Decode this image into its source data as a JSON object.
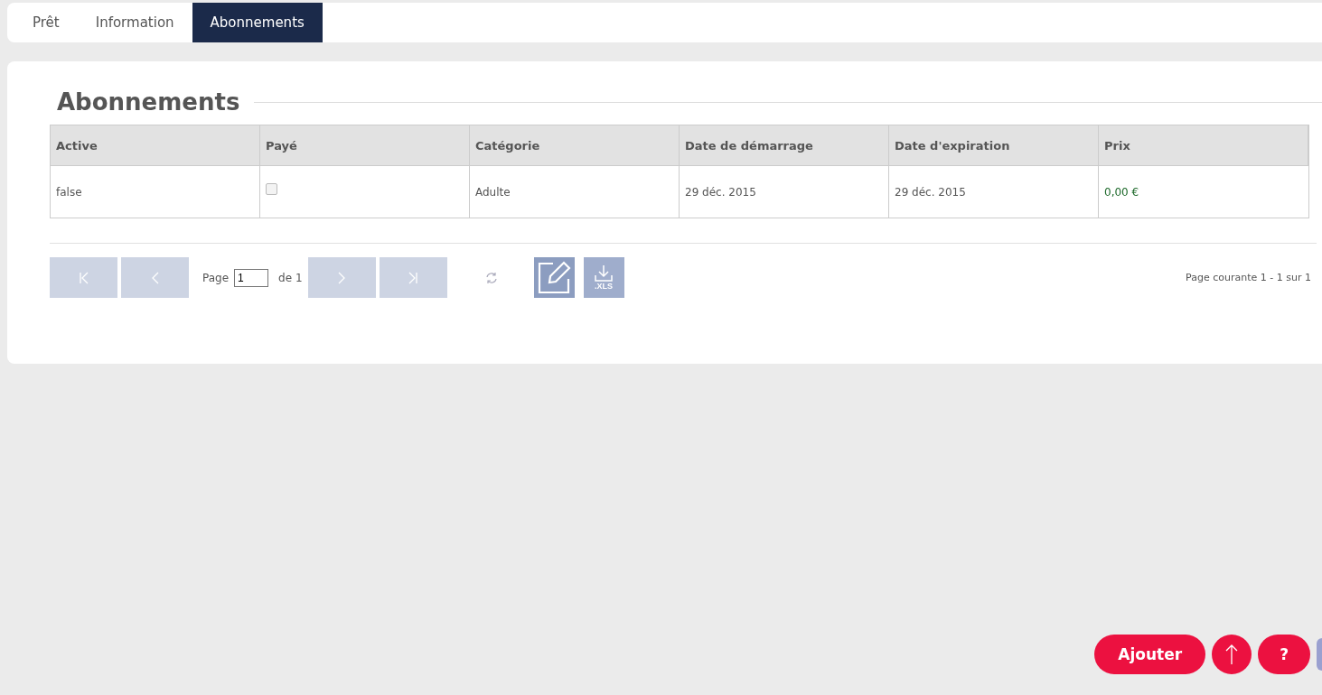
{
  "tabs": [
    {
      "label": "Prêt",
      "selected": false
    },
    {
      "label": "Information",
      "selected": false
    },
    {
      "label": "Abonnements",
      "selected": true
    }
  ],
  "section": {
    "title": "Abonnements"
  },
  "table": {
    "columns": [
      "Active",
      "Payé",
      "Catégorie",
      "Date de démarrage",
      "Date d'expiration",
      "Prix"
    ],
    "rows": [
      {
        "cells": [
          {
            "kind": "text",
            "text": "false"
          },
          {
            "kind": "checkbox",
            "checked": false
          },
          {
            "kind": "text",
            "text": "Adulte"
          },
          {
            "kind": "text",
            "text": "29 déc. 2015"
          },
          {
            "kind": "text",
            "text": "29 déc. 2015"
          },
          {
            "kind": "price",
            "text": "0,00 €"
          }
        ]
      }
    ]
  },
  "pager": {
    "page_label": "Page",
    "page_value": "1",
    "of_label": "de",
    "of_value": "1",
    "status_prefix": "Page courante",
    "status_from": "1",
    "status_sep": "-",
    "status_to": "1",
    "status_of": "sur",
    "status_total": "1",
    "export_label": ".XLS"
  },
  "actions": {
    "add": "Ajouter",
    "help": "?"
  }
}
